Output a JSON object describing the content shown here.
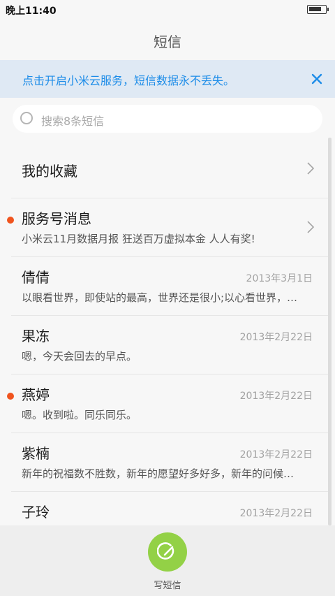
{
  "status_bar": {
    "time": "晚上11:40",
    "battery_level": 0.8
  },
  "header": {
    "title": "短信"
  },
  "banner": {
    "text": "点击开启小米云服务，短信数据永不丢失。",
    "accent_color": "#1c8ce8",
    "close_icon": "close-icon"
  },
  "search": {
    "placeholder": "搜索8条短信",
    "icon": "search-icon"
  },
  "list": {
    "favorites": {
      "label": "我的收藏"
    },
    "service": {
      "name": "服务号消息",
      "preview": "小米云11月数据月报 狂送百万虚拟本金 人人有奖!",
      "unread": true
    },
    "conversations": [
      {
        "name": "倩倩",
        "date": "2013年3月1日",
        "preview": "以眼看世界，即使站的最高，世界还是很小;以心看世界，…",
        "unread": false
      },
      {
        "name": "果冻",
        "date": "2013年2月22日",
        "preview": "嗯，今天会回去的早点。",
        "unread": false
      },
      {
        "name": "燕婷",
        "date": "2013年2月22日",
        "preview": "嗯。收到啦。同乐同乐。",
        "unread": true
      },
      {
        "name": "紫楠",
        "date": "2013年2月22日",
        "preview": "新年的祝福数不胜数，新年的愿望好多好多，新年的问候…",
        "unread": false
      },
      {
        "name": "子玲",
        "date": "2013年2月22日",
        "preview": "",
        "unread": false
      }
    ]
  },
  "compose": {
    "label": "写短信",
    "color": "#93d146",
    "icon": "compose-icon"
  },
  "colors": {
    "unread_dot": "#f0541e"
  }
}
